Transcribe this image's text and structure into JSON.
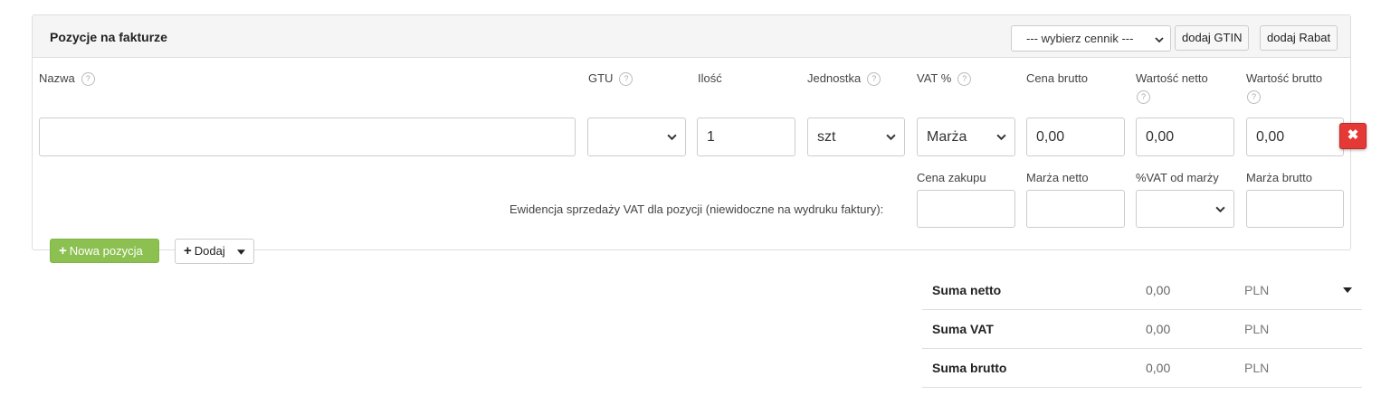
{
  "panel": {
    "title": "Pozycje na fakturze",
    "pricelist": "--- wybierz cennik ---",
    "gtin_button": "dodaj GTIN",
    "rabat_button": "dodaj Rabat"
  },
  "columns": {
    "nazwa": "Nazwa",
    "gtu": "GTU",
    "ilosc": "Ilość",
    "jednostka": "Jednostka",
    "vat": "VAT %",
    "cena_brutto": "Cena brutto",
    "wartosc_netto": "Wartość netto",
    "wartosc_brutto": "Wartość brutto",
    "help_icon": "?"
  },
  "row": {
    "nazwa": "",
    "gtu": "",
    "ilosc": "1",
    "jednostka": "szt",
    "vat": "Marża",
    "cena_brutto": "0,00",
    "wartosc_netto": "0,00",
    "wartosc_brutto": "0,00",
    "remove_icon": "✖"
  },
  "margin": {
    "note": "Ewidencja sprzedaży VAT dla pozycji (niewidoczne na wydruku faktury):",
    "cena_zakupu": "Cena zakupu",
    "marza_netto": "Marża netto",
    "vat_od_marzy": "%VAT od marży",
    "marza_brutto": "Marża brutto",
    "cena_zakupu_value": "",
    "marza_netto_value": "",
    "vat_od_marzy_value": "",
    "marza_brutto_value": ""
  },
  "actions": {
    "nowa_pozycja": "Nowa pozycja",
    "dodaj": "Dodaj",
    "plus_icon": "+"
  },
  "summary": [
    {
      "label": "Suma netto",
      "value": "0,00",
      "currency": "PLN"
    },
    {
      "label": "Suma VAT",
      "value": "0,00",
      "currency": "PLN"
    },
    {
      "label": "Suma brutto",
      "value": "0,00",
      "currency": "PLN"
    }
  ],
  "colors": {
    "accent_green": "#8cc152",
    "danger_red": "#e53935"
  }
}
